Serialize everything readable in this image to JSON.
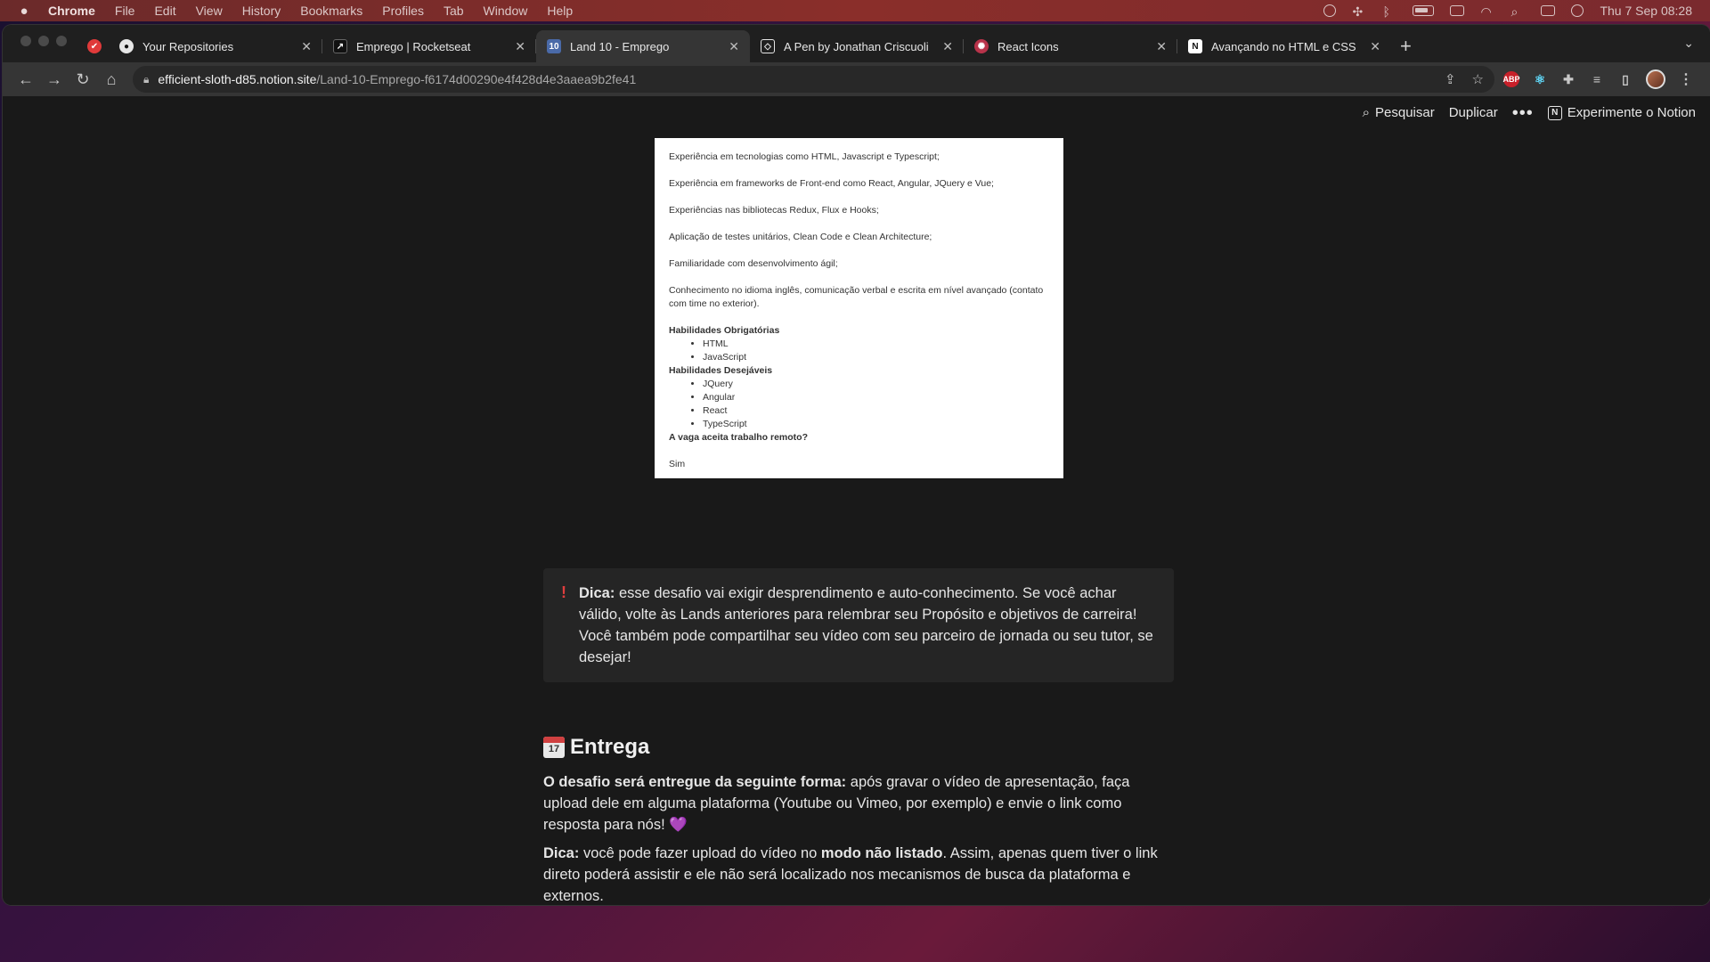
{
  "menubar": {
    "app": "Chrome",
    "items": [
      "File",
      "Edit",
      "View",
      "History",
      "Bookmarks",
      "Profiles",
      "Tab",
      "Window",
      "Help"
    ],
    "clock": "Thu 7 Sep  08:28"
  },
  "tabs": [
    {
      "title": "Your Repositories",
      "icon": "github-icon"
    },
    {
      "title": "Emprego | Rocketseat",
      "icon": "rocketseat-icon"
    },
    {
      "title": "Land 10 - Emprego",
      "icon": "notion-page-icon",
      "fav_text": "10"
    },
    {
      "title": "A Pen by Jonathan Criscuoli",
      "icon": "codepen-icon"
    },
    {
      "title": "React Icons",
      "icon": "react-icons-icon"
    },
    {
      "title": "Avançando no HTML e CSS",
      "icon": "notion-icon"
    }
  ],
  "omnibox": {
    "host": "efficient-sloth-d85.notion.site",
    "path": "/Land-10-Emprego-f6174d00290e4f428d4e3aaea9b2fe41"
  },
  "topbar": {
    "search": "Pesquisar",
    "duplicate": "Duplicar",
    "try_notion": "Experimente o Notion"
  },
  "doc_image": {
    "lines": [
      "Experiência em tecnologias como HTML, Javascript e Typescript;",
      "Experiência em frameworks de Front-end como React, Angular, JQuery e Vue;",
      "Experiências nas bibliotecas Redux, Flux e Hooks;",
      "Aplicação de testes unitários, Clean Code e Clean Architecture;",
      "Familiaridade com desenvolvimento ágil;",
      "Conhecimento no idioma inglês, comunicação verbal e escrita em nível avançado (contato com time no exterior)."
    ],
    "required_heading": "Habilidades Obrigatórias",
    "required": [
      "HTML",
      "JavaScript"
    ],
    "desired_heading": "Habilidades Desejáveis",
    "desired": [
      "JQuery",
      "Angular",
      "React",
      "TypeScript"
    ],
    "remote_question": "A vaga aceita trabalho remoto?",
    "remote_answer": "Sim"
  },
  "callout": {
    "label": "Dica:",
    "text": " esse desafio vai exigir desprendimento e auto-conhecimento. Se você achar válido, volte às Lands anteriores para relembrar seu Propósito e objetivos de carreira! Você também pode compartilhar seu vídeo com seu parceiro de jornada ou seu tutor, se desejar!"
  },
  "section": {
    "icon_number": "17",
    "title": "Entrega"
  },
  "paragraph1": {
    "bold": "O desafio será entregue da seguinte forma:",
    "text": " após gravar o vídeo de apresentação, faça upload dele em alguma plataforma (Youtube ou Vimeo, por exemplo) e envie o link como resposta para nós! ",
    "emoji": "💜"
  },
  "paragraph2": {
    "bold1": "Dica:",
    "text1": " você pode fazer upload do vídeo no ",
    "bold2": "modo não listado",
    "text2": ". Assim, apenas quem tiver o link direto poderá assistir e ele não será localizado nos mecanismos de busca da plataforma e externos."
  }
}
